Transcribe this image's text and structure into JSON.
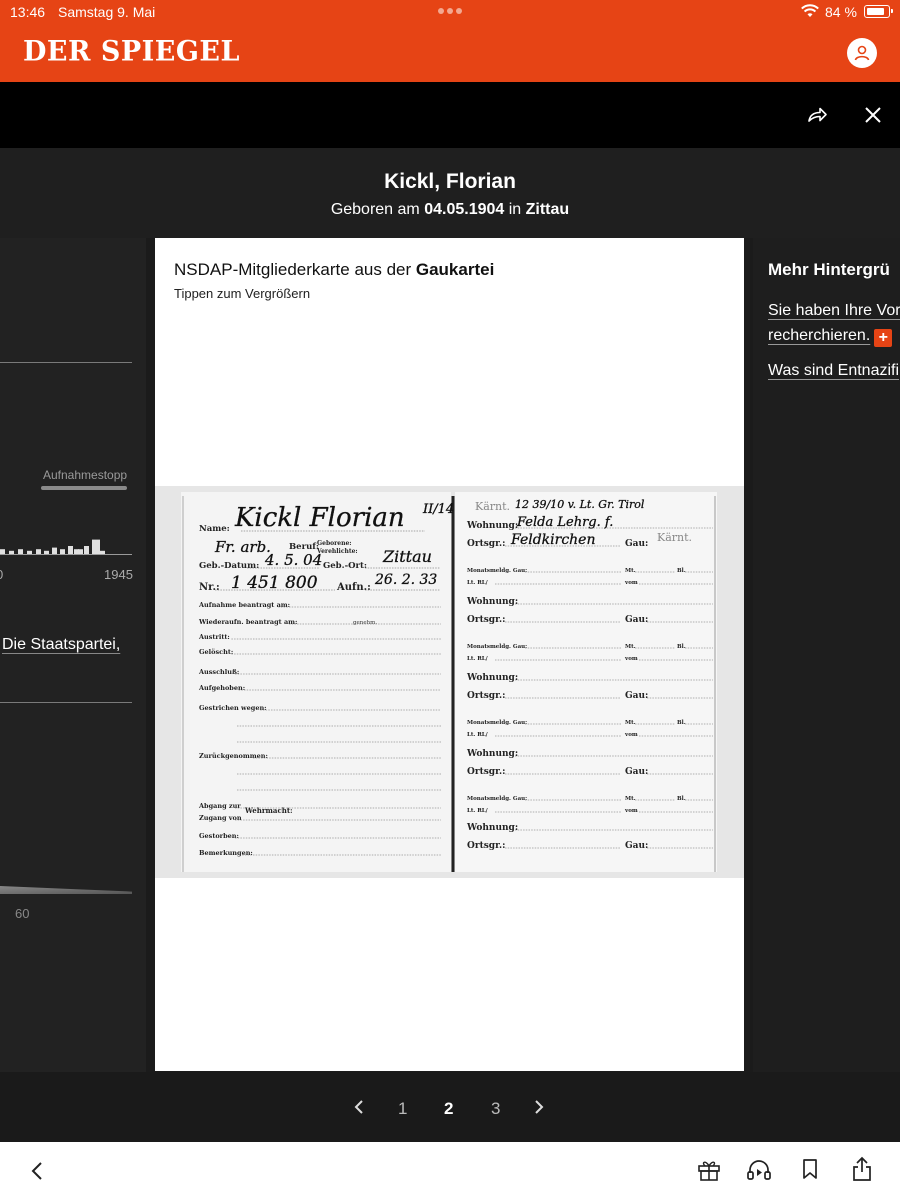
{
  "status_bar": {
    "time": "13:46",
    "date": "Samstag 9. Mai",
    "battery": "84 %"
  },
  "header": {
    "logo": "DER SPIEGEL",
    "brand_color": "#e64415"
  },
  "overlay": {
    "person_name": "Kickl, Florian",
    "born_prefix": "Geboren am ",
    "born_date": "04.05.1904",
    "born_in": " in ",
    "born_place": "Zittau"
  },
  "card": {
    "title_prefix": "NSDAP-Mitgliederkarte aus der ",
    "title_bold": "Gaukartei",
    "subtitle": "Tippen zum Vergrößern",
    "document": {
      "left": {
        "name_label": "Name:",
        "name_hand": "Kickl  Florian",
        "beruf_label": "Beruf:",
        "beruf_hand": "Fr. arb.",
        "geborene_label": "Geborene:",
        "verehelichte_label": "Verehlichte:",
        "geb_datum_label": "Geb.-Datum:",
        "geb_datum_hand": "4. 5. 04",
        "geb_ort_label": "Geb.-Ort:",
        "geb_ort_hand": "Zittau",
        "nr_label": "Nr.:",
        "nr_hand": "1 451 800",
        "aufn_label": "Aufn.:",
        "aufn_hand": "26. 2. 33",
        "rows": [
          "Aufnahme beantragt am:",
          "Wiederaufn. beantragt am:",
          "Austritt:",
          "Gelöscht:",
          "Ausschluß:",
          "Aufgehoben:",
          "Gestrichen wegen:",
          "Zurückgenommen:",
          "Abgang zur",
          "Zugang von",
          "Gestorben:",
          "Bemerkungen:"
        ],
        "genehm_label": "genehm.",
        "wehrmacht_label": "Wehrmacht:"
      },
      "right": {
        "stamp_top": "Kärnt.",
        "top_hand": "12 39/10 v. Lt. Gr. Tirol",
        "wohnung_label": "Wohnung:",
        "wohnung_hand": "Felda  Lehrg. f.",
        "ortsgr_label": "Ortsgr.:",
        "ortsgr_hand": "Feldkirchen",
        "gau_label": "Gau:",
        "gau_stamp": "Kärnt.",
        "monatsmeldg_label": "Monatsmeldg. Gau:",
        "mt_label": "Mt.",
        "bl_label": "Bl.",
        "ltrl_label": "Lt. RL/",
        "vom_label": "vom",
        "mark": "II/14"
      }
    }
  },
  "left_panel": {
    "aufnahmestopp": "Aufnahmestopp",
    "year_start": "0",
    "year_end": "1945",
    "link_text": "Die Staatspartei,",
    "axis_tick": "60",
    "bar_values": [
      3,
      2,
      3,
      2,
      3,
      2,
      4,
      3,
      5,
      3,
      3,
      5,
      9,
      2
    ]
  },
  "right_panel": {
    "heading": "Mehr Hintergrü",
    "link1": "Sie haben Ihre Vor",
    "link2": "recherchieren.",
    "link3": "Was sind Entnazifi",
    "plus": "+"
  },
  "pager": {
    "pages": [
      "1",
      "2",
      "3"
    ],
    "active": "2"
  },
  "toolbar": {
    "icons": [
      "back-icon",
      "gift-icon",
      "audio-icon",
      "bookmark-icon",
      "share-icon"
    ]
  }
}
